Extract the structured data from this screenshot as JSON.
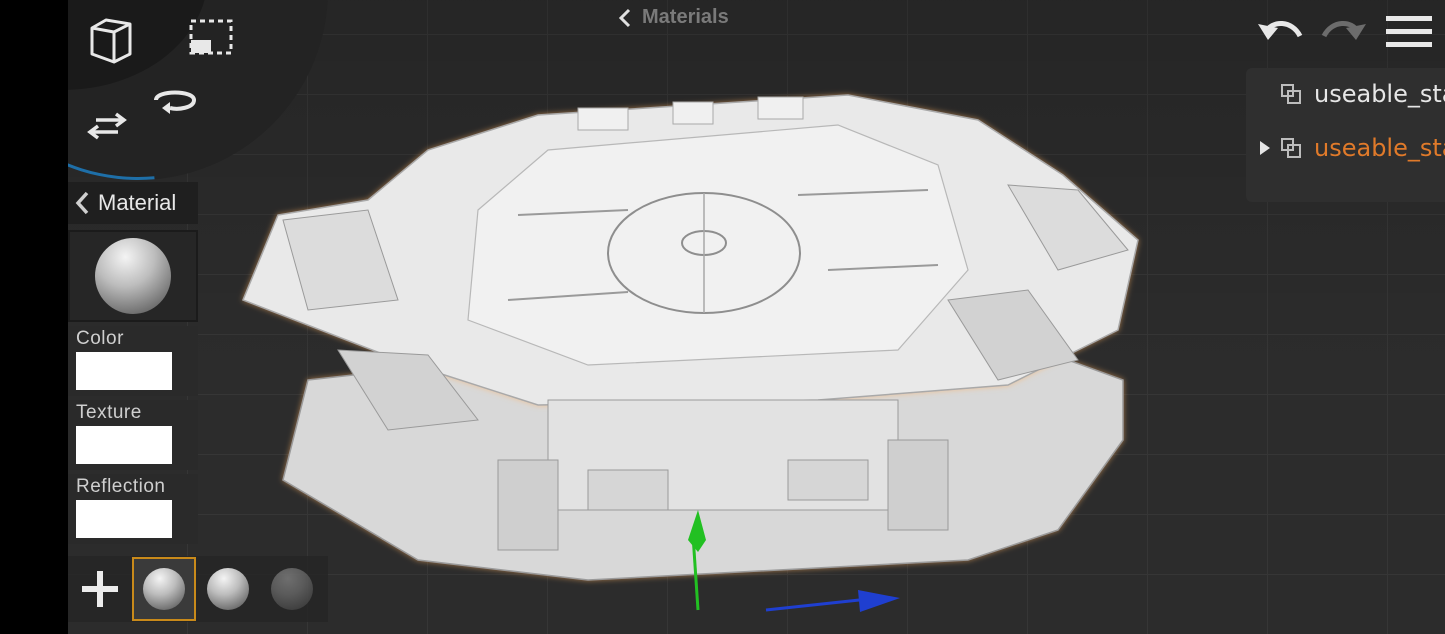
{
  "breadcrumb": {
    "label": "Materials"
  },
  "toolbar": {
    "undo": "undo-icon",
    "redo": "redo-icon",
    "menu": "menu-icon"
  },
  "tools": [
    "cube-view-icon",
    "selection-icon",
    "orbit-icon",
    "swap-icon"
  ],
  "scene_tree": {
    "items": [
      {
        "label": "useable_sta",
        "color": "#e6e6e6"
      },
      {
        "label": "useable_sta",
        "color": "#e07a2a"
      }
    ]
  },
  "material_panel": {
    "title": "Material",
    "properties": [
      {
        "label": "Color",
        "value": "#ffffff"
      },
      {
        "label": "Texture",
        "value": "#ffffff"
      },
      {
        "label": "Reflection",
        "value": "#ffffff"
      }
    ]
  },
  "material_slots": {
    "add_label": "+"
  },
  "colors": {
    "accent_orange": "#e07a2a",
    "gizmo_y": "#22c022",
    "gizmo_x": "#1f3fd0"
  }
}
